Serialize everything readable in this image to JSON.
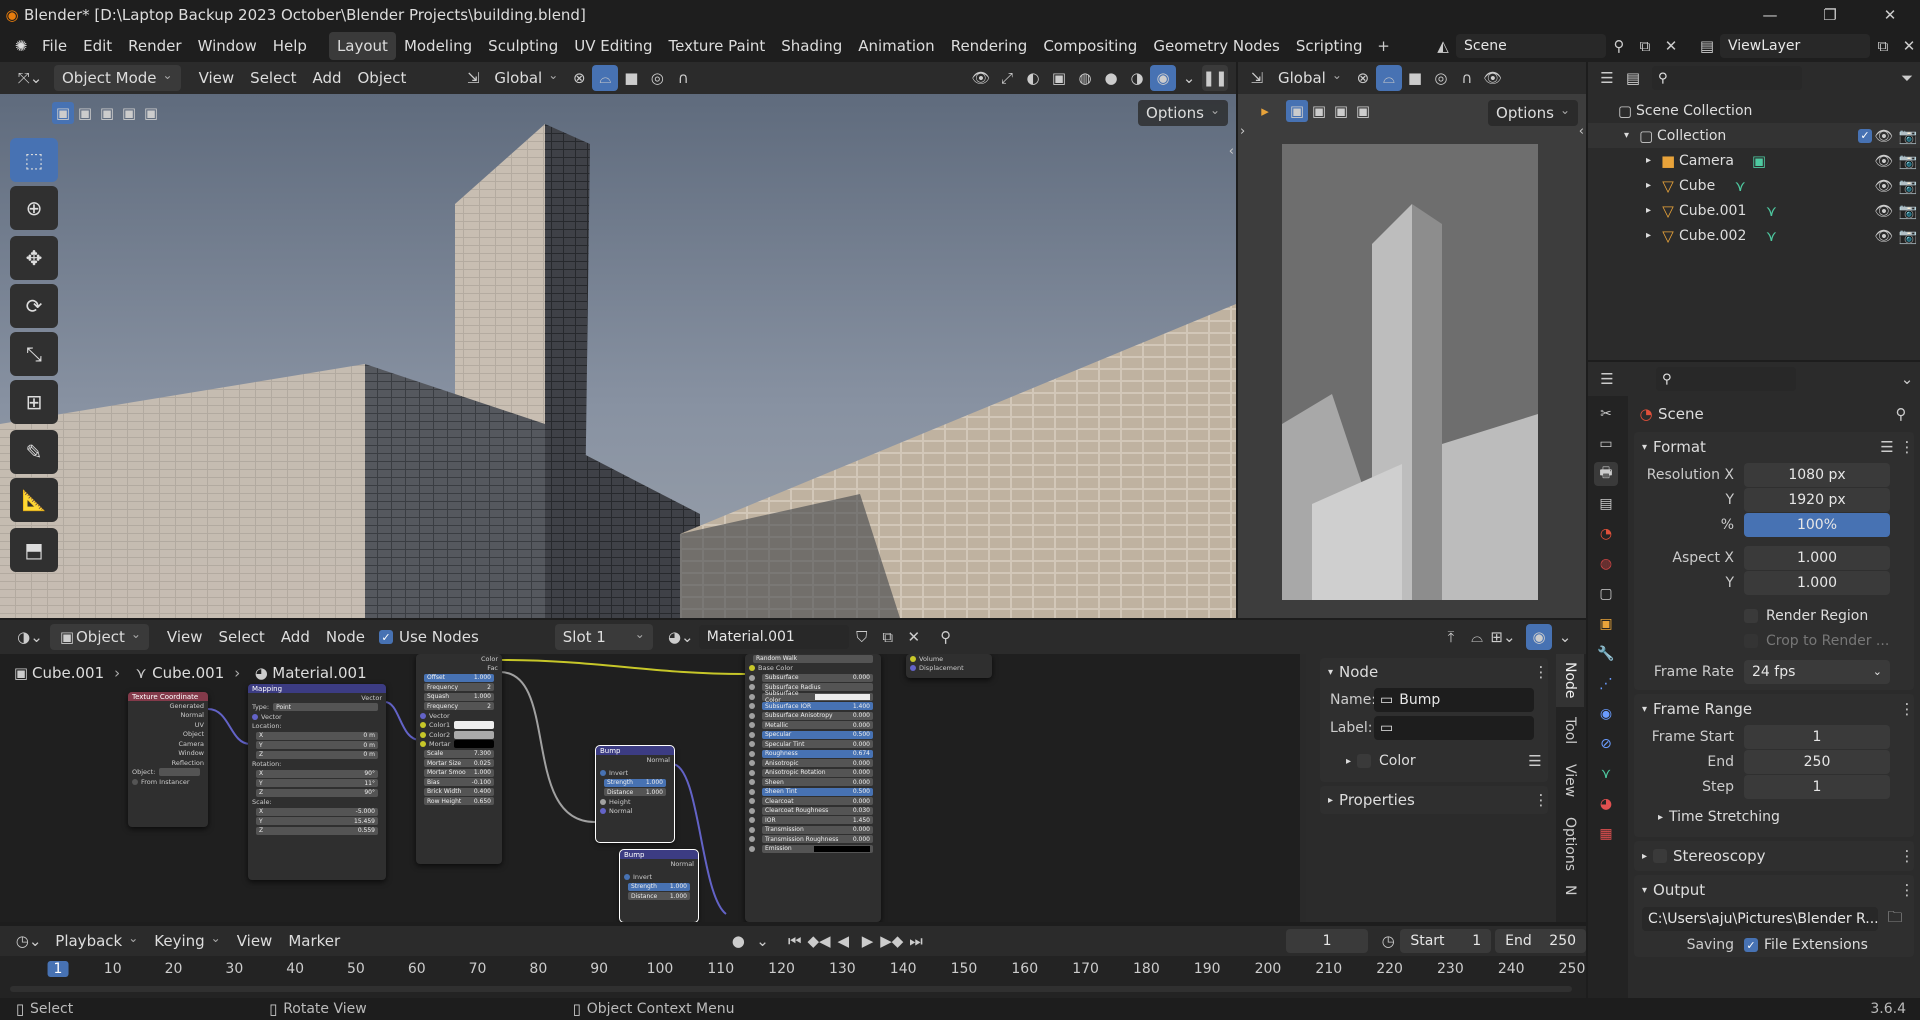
{
  "titlebar": {
    "title": "Blender* [D:\\Laptop Backup 2023 October\\Blender Projects\\building.blend]"
  },
  "menu": [
    "File",
    "Edit",
    "Render",
    "Window",
    "Help"
  ],
  "workspaces": [
    "Layout",
    "Modeling",
    "Sculpting",
    "UV Editing",
    "Texture Paint",
    "Shading",
    "Animation",
    "Rendering",
    "Compositing",
    "Geometry Nodes",
    "Scripting"
  ],
  "scene": {
    "name": "Scene",
    "view_layer": "ViewLayer"
  },
  "viewport": {
    "mode": "Object Mode",
    "menus": [
      "View",
      "Select",
      "Add",
      "Object"
    ],
    "orientation": "Global",
    "options": "Options"
  },
  "camview": {
    "orientation": "Global",
    "options": "Options"
  },
  "outliner": {
    "root": "Scene Collection",
    "collection": "Collection",
    "items": [
      {
        "name": "Camera"
      },
      {
        "name": "Cube"
      },
      {
        "name": "Cube.001"
      },
      {
        "name": "Cube.002"
      }
    ]
  },
  "properties": {
    "title": "Scene",
    "format": {
      "label": "Format",
      "res_x_label": "Resolution X",
      "res_x": "1080 px",
      "y_label": "Y",
      "res_y": "1920 px",
      "pct_label": "%",
      "pct": "100%",
      "aspect_x_label": "Aspect X",
      "aspect_x": "1.000",
      "aspect_y_label": "Y",
      "aspect_y": "1.000",
      "render_region": "Render Region",
      "crop": "Crop to Render ...",
      "frame_rate_label": "Frame Rate",
      "frame_rate": "24 fps"
    },
    "frame_range": {
      "label": "Frame Range",
      "start_label": "Frame Start",
      "start": "1",
      "end_label": "End",
      "end": "250",
      "step_label": "Step",
      "step": "1"
    },
    "time_stretching": "Time Stretching",
    "stereoscopy": "Stereoscopy",
    "output": {
      "label": "Output",
      "path": "C:\\Users\\aju\\Pictures\\Blender R...",
      "saving": "Saving",
      "file_ext": "File Extensions"
    }
  },
  "node_editor": {
    "editor_type": "Object",
    "menus": [
      "View",
      "Select",
      "Add",
      "Node"
    ],
    "use_nodes": "Use Nodes",
    "slot": "Slot 1",
    "material": "Material.001",
    "breadcrumb": [
      "Cube.001",
      "Cube.001",
      "Material.001"
    ],
    "sidebar": {
      "node_label": "Node",
      "name_label": "Name:",
      "name_value": "Bump",
      "label_label": "Label:",
      "label_value": "",
      "color_label": "Color",
      "properties_label": "Properties"
    },
    "tabs": [
      "Node",
      "Tool",
      "View",
      "Options",
      "N"
    ]
  },
  "nodes": {
    "texcoord": {
      "title": "Texture Coordinate",
      "outs": [
        "Generated",
        "Normal",
        "UV",
        "Object",
        "Camera",
        "Window",
        "Reflection"
      ],
      "object": "Object:",
      "instancer": "From Instancer"
    },
    "mapping": {
      "title": "Mapping",
      "out": "Vector",
      "type_label": "Type:",
      "type": "Point",
      "vector": "Vector",
      "location": "Location:",
      "loc": [
        [
          "X",
          "0 m"
        ],
        [
          "Y",
          "0 m"
        ],
        [
          "Z",
          "0 m"
        ]
      ],
      "rotation": "Rotation:",
      "rot": [
        [
          "X",
          "90°"
        ],
        [
          "Y",
          "11°"
        ],
        [
          "Z",
          "90°"
        ]
      ],
      "scale": "Scale:",
      "scl": [
        [
          "X",
          "-5.000"
        ],
        [
          "Y",
          "15.459"
        ],
        [
          "Z",
          "0.559"
        ]
      ]
    },
    "brick": {
      "outs": [
        "Color",
        "Fac"
      ],
      "rows": [
        [
          "Offset",
          "1.000"
        ],
        [
          "Frequency",
          "2"
        ],
        [
          "Squash",
          "1.000"
        ],
        [
          "Frequency",
          "2"
        ]
      ],
      "vector": "Vector",
      "color1": "Color1",
      "color2": "Color2",
      "mortar": "Mortar",
      "params": [
        [
          "Scale",
          "7.300"
        ],
        [
          "Mortar Size",
          "0.025"
        ],
        [
          "Mortar Smoo",
          "1.000"
        ],
        [
          "Bias",
          "-0.100"
        ],
        [
          "Brick Width",
          "0.400"
        ],
        [
          "Row Height",
          "0.650"
        ]
      ]
    },
    "bump1": {
      "title": "Bump",
      "out": "Normal",
      "invert": "Invert",
      "strength": [
        "Strength",
        "1.000"
      ],
      "distance": [
        "Distance",
        "1.000"
      ],
      "height": "Height",
      "normal": "Normal"
    },
    "bump2": {
      "title": "Bump",
      "out": "Normal",
      "invert": "Invert",
      "strength": [
        "Strength",
        "1.000"
      ],
      "distance": [
        "Distance",
        "1.000"
      ]
    },
    "bsdf": {
      "sss": "Random Walk",
      "base": "Base Color",
      "rows": [
        [
          "Subsurface",
          "0.000"
        ],
        [
          "Subsurface Radius",
          ""
        ],
        [
          "Subsurface Color",
          ""
        ],
        [
          "Subsurface IOR",
          "1.400"
        ],
        [
          "Subsurface Anisotropy",
          "0.000"
        ],
        [
          "Metallic",
          "0.000"
        ],
        [
          "Specular",
          "0.500"
        ],
        [
          "Specular Tint",
          "0.000"
        ],
        [
          "Roughness",
          "0.674"
        ],
        [
          "Anisotropic",
          "0.000"
        ],
        [
          "Anisotropic Rotation",
          "0.000"
        ],
        [
          "Sheen",
          "0.000"
        ],
        [
          "Sheen Tint",
          "0.500"
        ],
        [
          "Clearcoat",
          "0.000"
        ],
        [
          "Clearcoat Roughness",
          "0.030"
        ],
        [
          "IOR",
          "1.450"
        ],
        [
          "Transmission",
          "0.000"
        ],
        [
          "Transmission Roughness",
          "0.000"
        ],
        [
          "Emission",
          ""
        ]
      ]
    },
    "output": {
      "rows": [
        "Volume",
        "Displacement"
      ]
    }
  },
  "timeline": {
    "menus": [
      "Playback",
      "Keying",
      "View",
      "Marker"
    ],
    "current": "1",
    "start_label": "Start",
    "start": "1",
    "end_label": "End",
    "end": "250",
    "ticks": [
      "1",
      "10",
      "20",
      "30",
      "40",
      "50",
      "60",
      "70",
      "80",
      "90",
      "100",
      "110",
      "120",
      "130",
      "140",
      "150",
      "160",
      "170",
      "180",
      "190",
      "200",
      "210",
      "220",
      "230",
      "240",
      "250"
    ]
  },
  "statusbar": {
    "select": "Select",
    "rotate": "Rotate View",
    "context": "Object Context Menu",
    "version": "3.6.4"
  }
}
